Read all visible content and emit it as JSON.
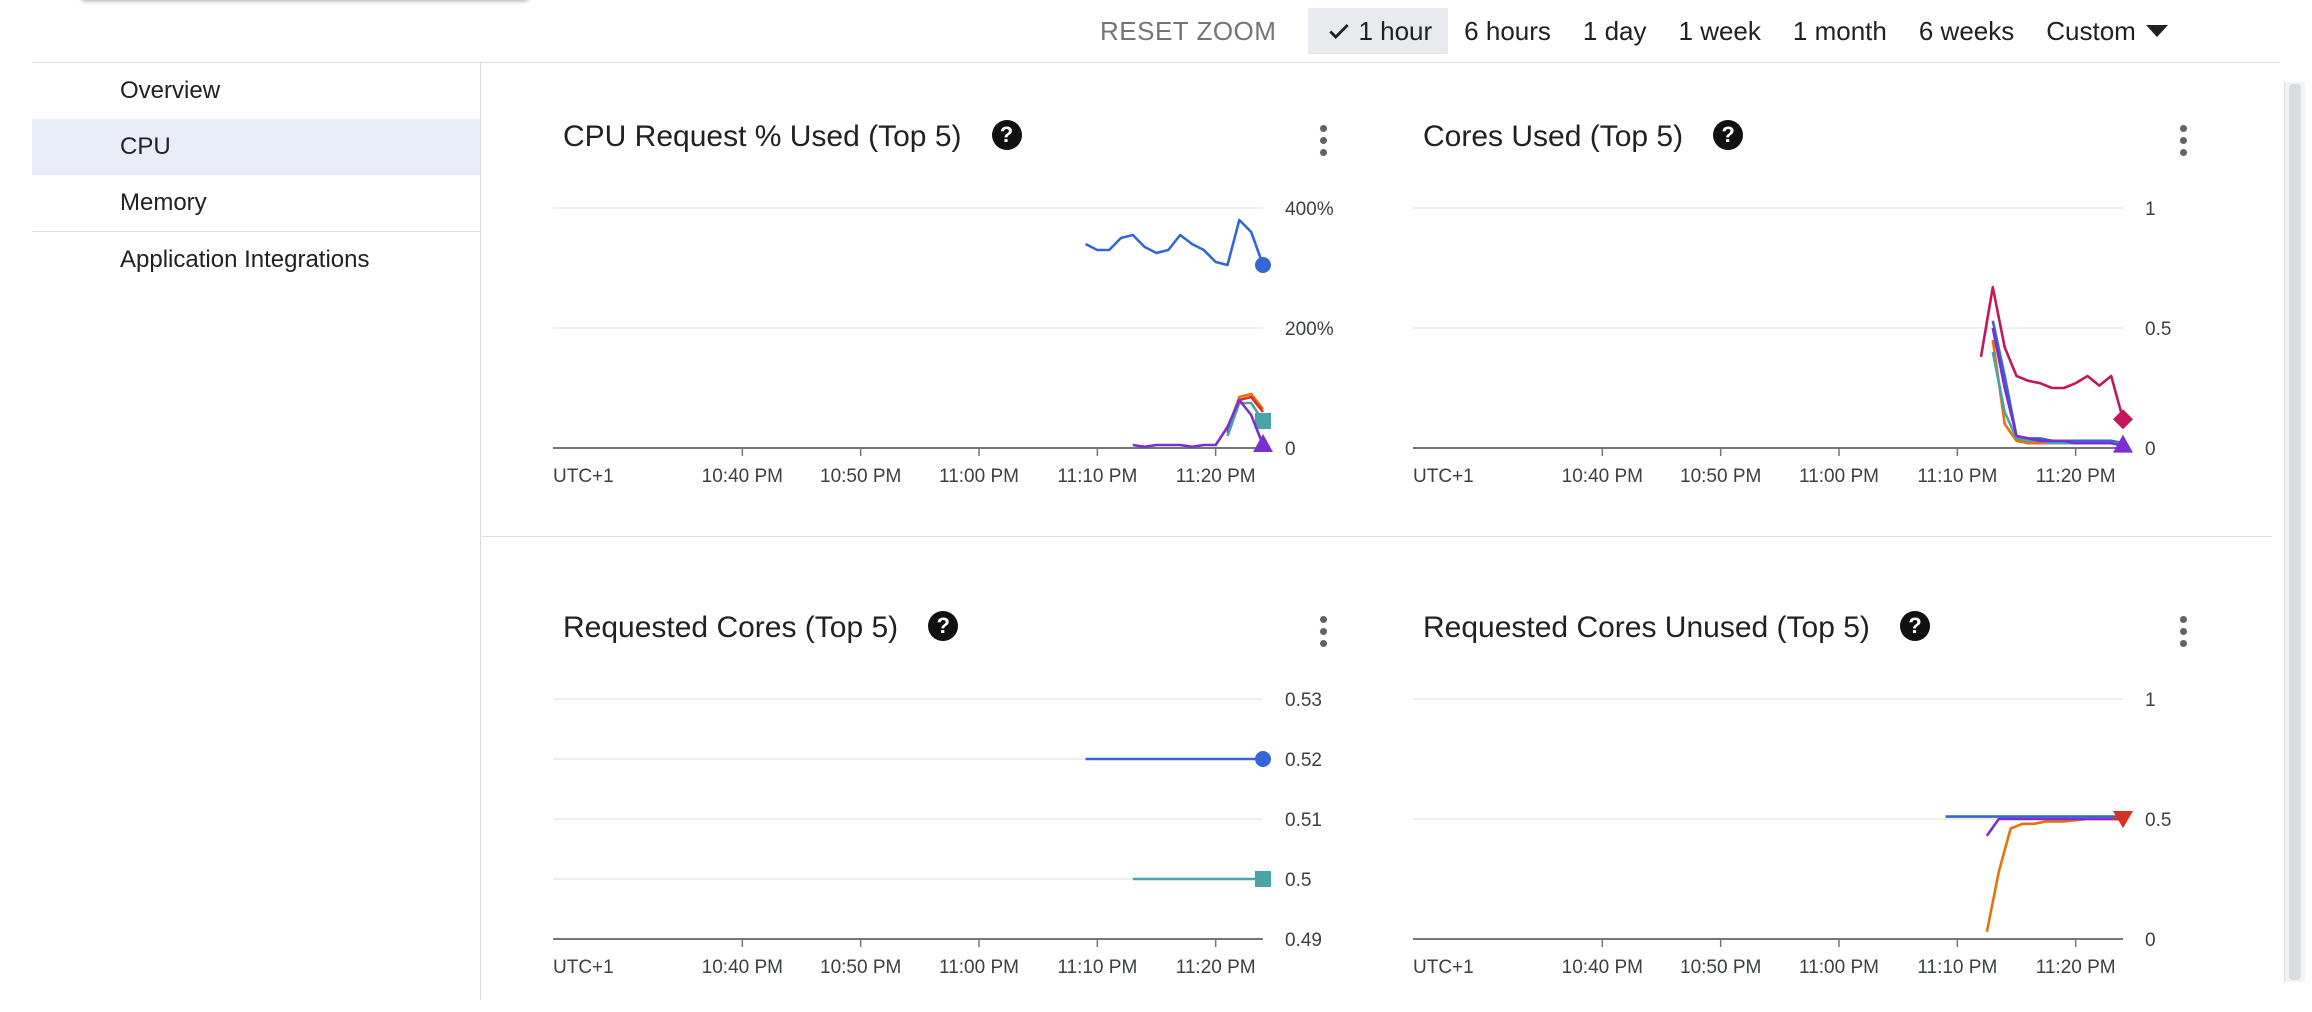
{
  "timebar": {
    "reset": "RESET ZOOM",
    "selected": "1 hour",
    "ranges": [
      "6 hours",
      "1 day",
      "1 week",
      "1 month",
      "6 weeks"
    ],
    "custom": "Custom"
  },
  "sidebar": {
    "items": [
      {
        "label": "Overview"
      },
      {
        "label": "CPU"
      },
      {
        "label": "Memory"
      },
      {
        "label": "Application Integrations"
      }
    ]
  },
  "colors": {
    "blue": "#3367d6",
    "purple": "#7b2fd0",
    "orange": "#e8710a",
    "red": "#d93025",
    "teal": "#4aa3a9",
    "pink": "#c2185b",
    "grid": "#e8eaed",
    "axis": "#757575",
    "sidebar_active": "#e8edf8"
  },
  "charts": [
    {
      "title": "CPU Request % Used (Top 5)",
      "chart_data": {
        "type": "line",
        "xlabel": "UTC+1",
        "xticks": [
          "10:40 PM",
          "10:50 PM",
          "11:00 PM",
          "11:10 PM",
          "11:20 PM"
        ],
        "x_range": [
          "10:24 PM",
          "11:24 PM"
        ],
        "ylim": [
          0,
          400
        ],
        "yticks": [
          "0",
          "200%",
          "400%"
        ],
        "series": [
          {
            "color": "#3367d6",
            "marker": "circle",
            "x": [
              1109,
              1110,
              1111,
              1112,
              1113,
              1114,
              1115,
              1116,
              1117,
              1118,
              1119,
              1120,
              1121,
              1122,
              1123,
              1124
            ],
            "y": [
              340,
              330,
              330,
              350,
              355,
              335,
              325,
              330,
              355,
              340,
              330,
              310,
              305,
              380,
              360,
              305
            ]
          },
          {
            "color": "#e8710a",
            "marker": "none",
            "x": [
              1121,
              1122,
              1123,
              1124
            ],
            "y": [
              30,
              85,
              90,
              65
            ]
          },
          {
            "color": "#d93025",
            "marker": "none",
            "x": [
              1121,
              1122,
              1123,
              1124
            ],
            "y": [
              25,
              80,
              85,
              60
            ]
          },
          {
            "color": "#4aa3a9",
            "marker": "square",
            "x": [
              1121,
              1122,
              1123,
              1124
            ],
            "y": [
              20,
              75,
              75,
              45
            ]
          },
          {
            "color": "#7b2fd0",
            "marker": "triangle",
            "x": [
              1113,
              1114,
              1115,
              1116,
              1117,
              1118,
              1119,
              1120,
              1121,
              1122,
              1123,
              1124
            ],
            "y": [
              5,
              2,
              5,
              5,
              5,
              2,
              5,
              5,
              35,
              80,
              55,
              5
            ]
          }
        ]
      }
    },
    {
      "title": "Cores Used (Top 5)",
      "chart_data": {
        "type": "line",
        "xlabel": "UTC+1",
        "xticks": [
          "10:40 PM",
          "10:50 PM",
          "11:00 PM",
          "11:10 PM",
          "11:20 PM"
        ],
        "x_range": [
          "10:24 PM",
          "11:24 PM"
        ],
        "ylim": [
          0,
          1
        ],
        "yticks": [
          "0",
          "0.5",
          "1"
        ],
        "series": [
          {
            "color": "#c2185b",
            "marker": "diamond",
            "x": [
              1112,
              1113,
              1114,
              1115,
              1116,
              1117,
              1118,
              1119,
              1120,
              1121,
              1122,
              1123,
              1124
            ],
            "y": [
              0.38,
              0.67,
              0.42,
              0.3,
              0.28,
              0.27,
              0.25,
              0.25,
              0.27,
              0.3,
              0.26,
              0.3,
              0.12
            ]
          },
          {
            "color": "#3367d6",
            "marker": "none",
            "x": [
              1113,
              1114,
              1115,
              1116,
              1117,
              1118,
              1119,
              1120,
              1121,
              1122,
              1123,
              1124
            ],
            "y": [
              0.53,
              0.3,
              0.05,
              0.04,
              0.04,
              0.03,
              0.03,
              0.03,
              0.03,
              0.03,
              0.03,
              0.02
            ]
          },
          {
            "color": "#e8710a",
            "marker": "none",
            "x": [
              1113,
              1114,
              1115,
              1116,
              1117,
              1118,
              1119,
              1120,
              1121,
              1122,
              1123,
              1124
            ],
            "y": [
              0.45,
              0.1,
              0.03,
              0.02,
              0.02,
              0.02,
              0.02,
              0.02,
              0.02,
              0.02,
              0.02,
              0.02
            ]
          },
          {
            "color": "#4aa3a9",
            "marker": "none",
            "x": [
              1113,
              1114,
              1115,
              1116,
              1117,
              1118,
              1119,
              1120,
              1121,
              1122,
              1123,
              1124
            ],
            "y": [
              0.4,
              0.15,
              0.04,
              0.03,
              0.03,
              0.02,
              0.02,
              0.02,
              0.02,
              0.02,
              0.02,
              0.02
            ]
          },
          {
            "color": "#7b2fd0",
            "marker": "triangle",
            "x": [
              1113,
              1114,
              1115,
              1116,
              1117,
              1118,
              1119,
              1120,
              1121,
              1122,
              1123,
              1124
            ],
            "y": [
              0.5,
              0.25,
              0.05,
              0.04,
              0.03,
              0.03,
              0.03,
              0.02,
              0.02,
              0.02,
              0.02,
              0.01
            ]
          }
        ]
      }
    },
    {
      "title": "Requested Cores (Top 5)",
      "chart_data": {
        "type": "line",
        "xlabel": "UTC+1",
        "xticks": [
          "10:40 PM",
          "10:50 PM",
          "11:00 PM",
          "11:10 PM",
          "11:20 PM"
        ],
        "x_range": [
          "10:24 PM",
          "11:24 PM"
        ],
        "ylim": [
          0.49,
          0.53
        ],
        "yticks": [
          "0.49",
          "0.5",
          "0.51",
          "0.52",
          "0.53"
        ],
        "series": [
          {
            "color": "#3367d6",
            "marker": "circle",
            "x": [
              1109,
              1124
            ],
            "y": [
              0.52,
              0.52
            ]
          },
          {
            "color": "#4aa3a9",
            "marker": "square",
            "x": [
              1113,
              1124
            ],
            "y": [
              0.5,
              0.5
            ]
          }
        ]
      }
    },
    {
      "title": "Requested Cores Unused (Top 5)",
      "chart_data": {
        "type": "line",
        "xlabel": "UTC+1",
        "xticks": [
          "10:40 PM",
          "10:50 PM",
          "11:00 PM",
          "11:10 PM",
          "11:20 PM"
        ],
        "x_range": [
          "10:24 PM",
          "11:24 PM"
        ],
        "ylim": [
          0,
          1
        ],
        "yticks": [
          "0",
          "0.5",
          "1"
        ],
        "series": [
          {
            "color": "#3367d6",
            "marker": "none",
            "x": [
              1109,
              1124
            ],
            "y": [
              0.51,
              0.51
            ]
          },
          {
            "color": "#e8710a",
            "marker": "down-triangle",
            "x": [
              1112.5,
              1113.5,
              1114.5,
              1115.5,
              1116.5,
              1117.5,
              1119,
              1121,
              1124
            ],
            "y": [
              0.03,
              0.28,
              0.46,
              0.48,
              0.48,
              0.49,
              0.49,
              0.5,
              0.5
            ]
          },
          {
            "color": "#7b2fd0",
            "marker": "none",
            "x": [
              1112.5,
              1113.5,
              1115,
              1117,
              1119,
              1121,
              1124
            ],
            "y": [
              0.43,
              0.5,
              0.5,
              0.5,
              0.5,
              0.5,
              0.5
            ]
          },
          {
            "color": "#d93025",
            "marker": "down-triangle",
            "x": [
              1123,
              1124
            ],
            "y": [
              0.5,
              0.5
            ]
          }
        ]
      }
    }
  ]
}
